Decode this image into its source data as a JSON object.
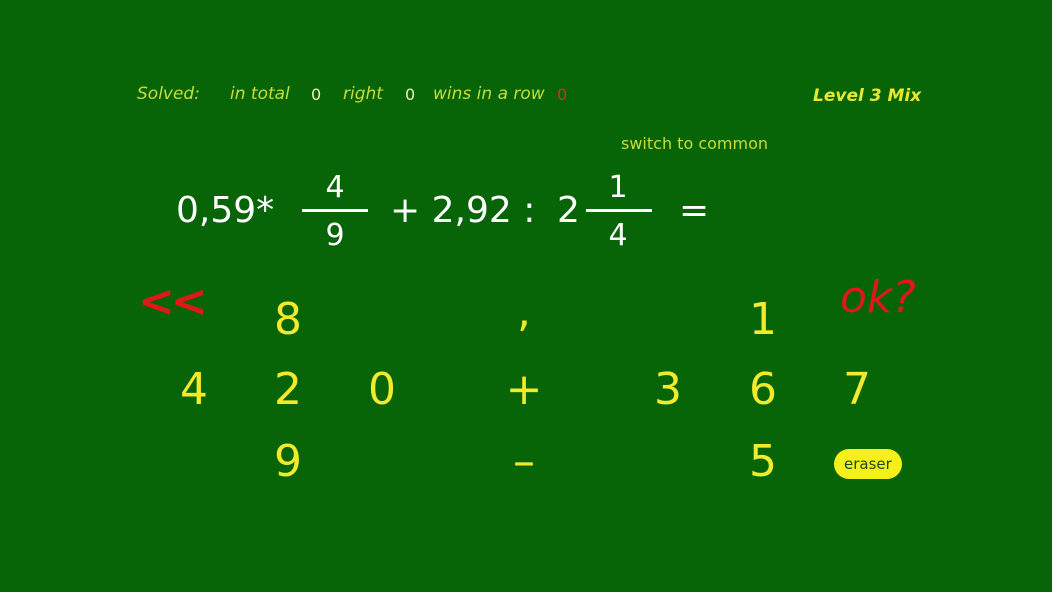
{
  "stats": {
    "solved_label": "Solved:",
    "total_label": "in total",
    "total_value": "0",
    "right_label": "right",
    "right_value": "0",
    "wins_label": "wins in a row",
    "wins_value": "0"
  },
  "level": "Level 3 Mix",
  "switch_label": "switch to common",
  "expression": {
    "term1": "0,59*",
    "frac1_num": "4",
    "frac1_den": "9",
    "middle": "+ 2,92 :",
    "whole2": "2",
    "frac2_num": "1",
    "frac2_den": "4",
    "equals": "="
  },
  "keypad": {
    "back": "<<",
    "ok": "ok?",
    "eraser": "eraser",
    "k8": "8",
    "kcomma": ",",
    "k1": "1",
    "k4": "4",
    "k2": "2",
    "k0": "0",
    "kplus": "+",
    "k3": "3",
    "k6": "6",
    "k7": "7",
    "k9": "9",
    "kminus": "–",
    "k5": "5"
  },
  "colors": {
    "background": "#076507",
    "key_yellow": "#f2ea2a",
    "accent_red": "#e01818"
  }
}
